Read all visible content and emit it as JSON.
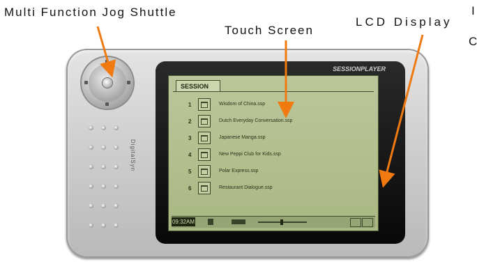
{
  "callouts": {
    "jog": "Multi Function Jog Shuttle",
    "touch": "Touch Screen",
    "lcd": "LCD Display",
    "cut_1": "I",
    "cut_2": "C"
  },
  "colors": {
    "arrow": "#f07a10",
    "screen": "#b4c08f",
    "bezel": "#111111",
    "body": "#cfcfcf"
  },
  "device": {
    "bezel_title": "SESSIONPLAYER",
    "brand": "DigitalSyn",
    "model": "",
    "tabs": [
      "SESSION",
      "",
      "",
      ""
    ],
    "sessions": [
      {
        "num": "1",
        "name": "Wisdom of China.ssp",
        "icon": "file-icon"
      },
      {
        "num": "2",
        "name": "Dutch Everyday Conversation.ssp",
        "icon": "file-icon"
      },
      {
        "num": "3",
        "name": "Japanese Manga.ssp",
        "icon": "file-icon"
      },
      {
        "num": "4",
        "name": "New Peppi Club for Kids.ssp",
        "icon": "file-icon"
      },
      {
        "num": "5",
        "name": "Polar Express.ssp",
        "icon": "file-icon"
      },
      {
        "num": "6",
        "name": "Restaurant Dialogue.ssp",
        "icon": "file-icon"
      }
    ],
    "clock": "09:32AM"
  }
}
